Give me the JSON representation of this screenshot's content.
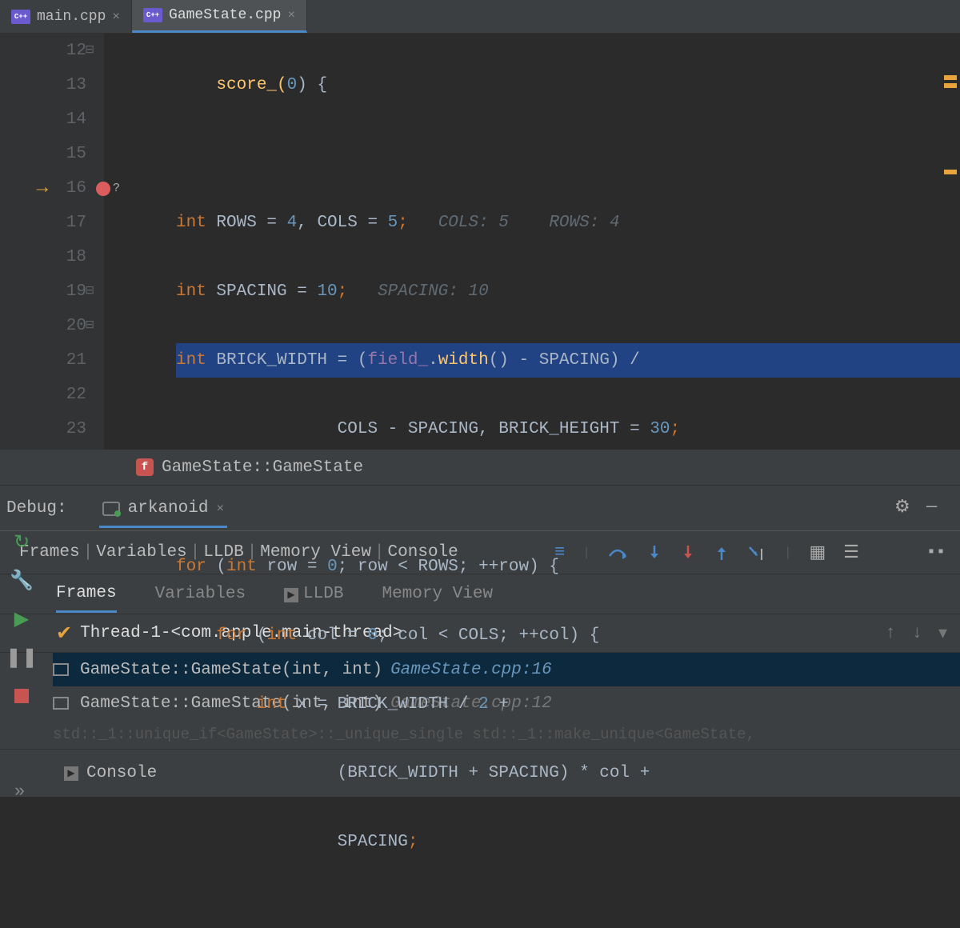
{
  "tabs": [
    {
      "label": "main.cpp",
      "active": false
    },
    {
      "label": "GameState.cpp",
      "active": true
    }
  ],
  "gutter": {
    "lines": [
      "12",
      "13",
      "14",
      "15",
      "16",
      "17",
      "18",
      "19",
      "20",
      "21",
      "22",
      "23"
    ],
    "breakpoint_line_index": 4
  },
  "code": {
    "l12_a": "score_(",
    "l12_n": "0",
    "l12_b": ") {",
    "l14_kw": "int",
    "l14_r": " ROWS = ",
    "l14_n1": "4",
    "l14_c": ", COLS = ",
    "l14_n2": "5",
    "l14_sc": ";",
    "l14_hint": "   COLS: 5    ROWS: 4",
    "l15_kw": "int",
    "l15_a": " SPACING = ",
    "l15_n": "10",
    "l15_sc": ";",
    "l15_hint": "   SPACING: 10",
    "l16_kw": "int",
    "l16_a": " BRICK_WIDTH = (",
    "l16_f": "field_",
    "l16_d": ".",
    "l16_call": "width",
    "l16_b": "() - SPACING) /",
    "l17": "                COLS - SPACING, BRICK_HEIGHT = ",
    "l17_n": "30",
    "l17_sc": ";",
    "l19_for": "for ",
    "l19_p": "(",
    "l19_kw": "int",
    "l19_a": " row = ",
    "l19_n": "0",
    "l19_b": "; row < ROWS; ++row) {",
    "l20_sp": "    ",
    "l20_for": "for ",
    "l20_p": "(",
    "l20_kw": "int",
    "l20_a": " col = ",
    "l20_n": "0",
    "l20_b": "; col < COLS; ++col) {",
    "l21_sp": "        ",
    "l21_kw": "int",
    "l21_a": " x = BRICK_WIDTH / ",
    "l21_n": "2",
    "l21_b": " +",
    "l22": "                (BRICK_WIDTH + SPACING) * col +",
    "l23": "                SPACING",
    "l23_sc": ";"
  },
  "breadcrumb": {
    "text": "GameState::GameState"
  },
  "debug": {
    "label": "Debug:",
    "config": "arkanoid",
    "crumbs": [
      "Frames",
      "Variables",
      "LLDB",
      "Memory View",
      "Console"
    ],
    "tabs": [
      "Frames",
      "Variables",
      "LLDB",
      "Memory View"
    ],
    "active_tab_index": 0,
    "thread": "Thread-1-<com.apple.main-thread>",
    "frames": [
      {
        "sig": "GameState::GameState(int, int)",
        "loc": "GameState.cpp:16",
        "selected": true
      },
      {
        "sig": "GameState::GameState(int, int)",
        "loc": "GameState.cpp:12",
        "selected": false
      }
    ],
    "faded_frame": " std::_1::unique_if<GameState>::_unique_single std::_1::make_unique<GameState,",
    "console_label": "Console"
  }
}
